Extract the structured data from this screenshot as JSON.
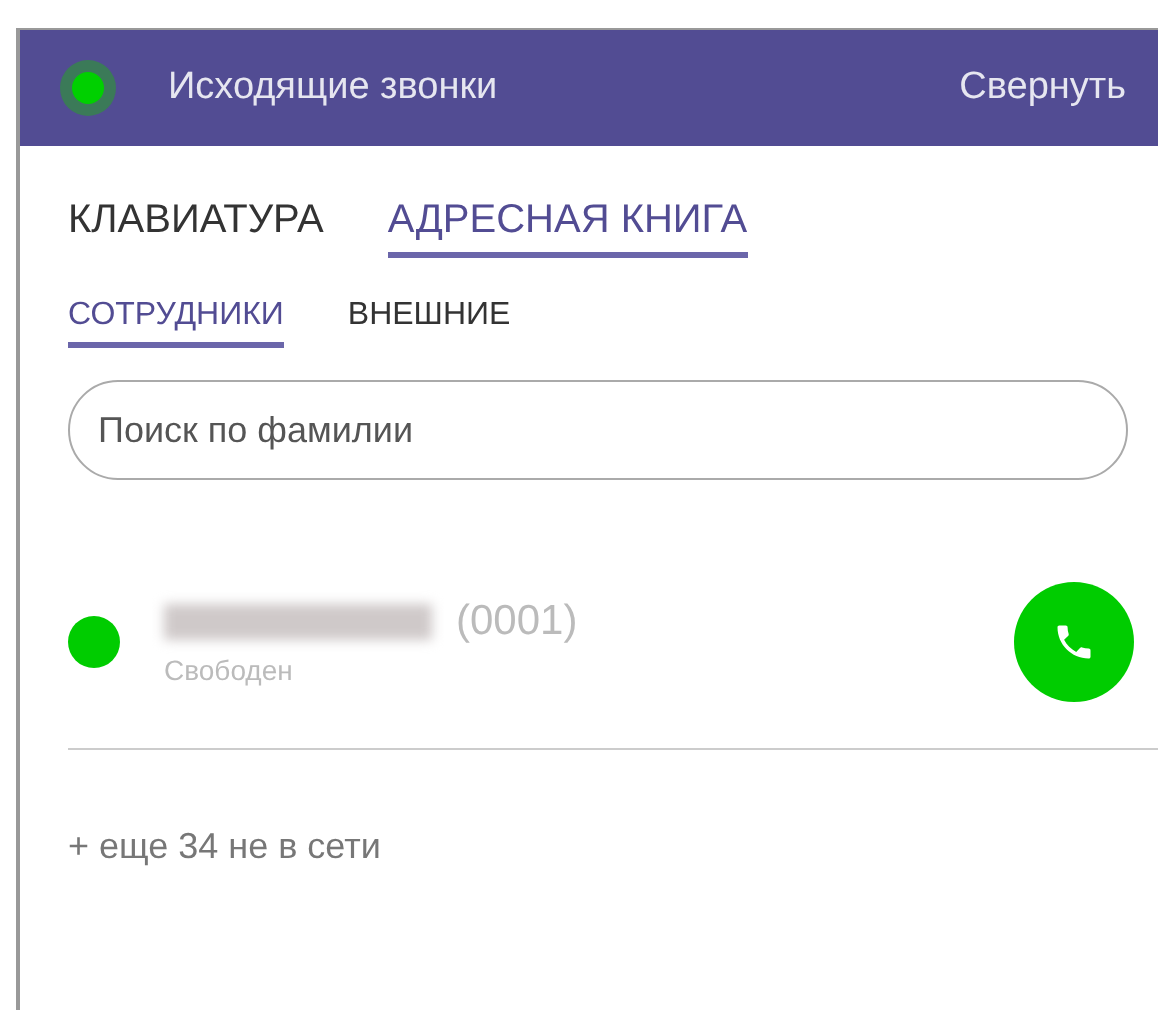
{
  "header": {
    "connected": true,
    "title": "Исходящие звонки",
    "collapse": "Свернуть"
  },
  "tabs": [
    {
      "label": "КЛАВИАТУРА",
      "selected": false
    },
    {
      "label": "АДРЕСНАЯ КНИГА",
      "selected": true
    }
  ],
  "subtabs": [
    {
      "label": "СОТРУДНИКИ",
      "selected": true
    },
    {
      "label": "ВНЕШНИЕ",
      "selected": false
    }
  ],
  "search": {
    "placeholder": "Поиск по фамилии"
  },
  "contacts": [
    {
      "extension": "(0001)",
      "status": "Свободен",
      "color": "#00cc00"
    }
  ],
  "offline_note": "+ еще 34 не в сети"
}
